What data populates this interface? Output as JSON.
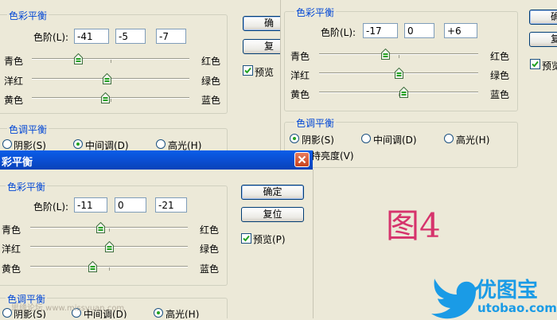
{
  "top_left": {
    "group_title": "色彩平衡",
    "levels_label": "色阶(L):",
    "levels": [
      "-41",
      "-5",
      "-7"
    ],
    "sliders": [
      {
        "left": "青色",
        "right": "红色",
        "value": -41
      },
      {
        "left": "洋红",
        "right": "绿色",
        "value": -5
      },
      {
        "left": "黄色",
        "right": "蓝色",
        "value": -7
      }
    ],
    "ok_label": "确",
    "reset_label": "复",
    "preview_label": "预览",
    "tone_title": "色调平衡",
    "tones": [
      "阴影(S)",
      "中间调(D)",
      "高光(H)"
    ]
  },
  "top_right": {
    "group_title": "色彩平衡",
    "levels_label": "色阶(L):",
    "levels": [
      "-17",
      "0",
      "+6"
    ],
    "sliders": [
      {
        "left": "青色",
        "right": "红色",
        "value": -17
      },
      {
        "left": "洋红",
        "right": "绿色",
        "value": 0
      },
      {
        "left": "黄色",
        "right": "蓝色",
        "value": 6
      }
    ],
    "ok_label": "确",
    "reset_label": "复",
    "preview_label": "预览",
    "tone_title": "色调平衡",
    "tones": [
      "阴影(S)",
      "中间调(D)",
      "高光(H)"
    ],
    "preserve_label": "持亮度(V)"
  },
  "bottom_left": {
    "window_title": "彩平衡",
    "group_title": "色彩平衡",
    "levels_label": "色阶(L):",
    "levels": [
      "-11",
      "0",
      "-21"
    ],
    "sliders": [
      {
        "left": "青色",
        "right": "红色",
        "value": -11
      },
      {
        "left": "洋红",
        "right": "绿色",
        "value": 0
      },
      {
        "left": "黄色",
        "right": "蓝色",
        "value": -21
      }
    ],
    "ok_label": "确定",
    "reset_label": "复位",
    "preview_label": "预览(P)",
    "tone_title": "色调平衡",
    "tones": [
      "阴影(S)",
      "中间调(D)",
      "高光(H)"
    ]
  },
  "figure_label": "图4",
  "forum_watermark": "思缘论坛 www.missyuan.com",
  "logo": {
    "name": "优图宝",
    "url": "utobao.com"
  },
  "colors": {
    "group_title": "#0046d5",
    "figure_label": "#d6336c",
    "logo_blue": "#1a9be6"
  }
}
